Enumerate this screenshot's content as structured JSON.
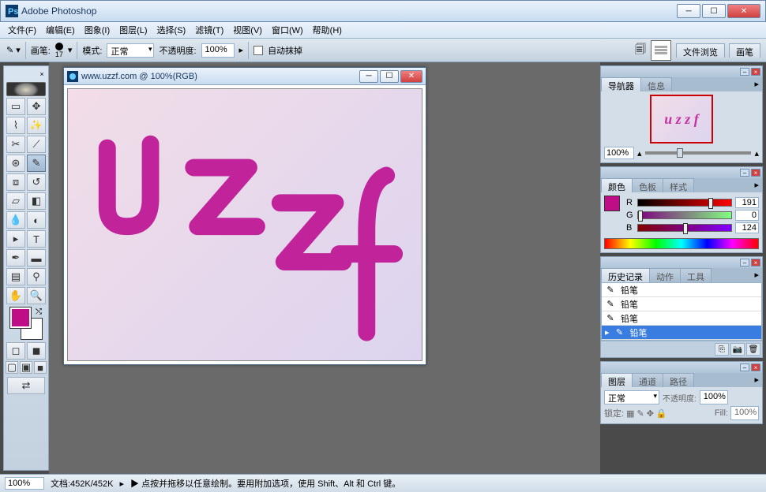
{
  "app": {
    "title": "Adobe Photoshop"
  },
  "menu": [
    "文件(F)",
    "编辑(E)",
    "图象(I)",
    "图层(L)",
    "选择(S)",
    "滤镜(T)",
    "视图(V)",
    "窗口(W)",
    "帮助(H)"
  ],
  "options": {
    "brush_label": "画笔:",
    "brush_size": "17",
    "mode_label": "模式:",
    "mode_value": "正常",
    "opacity_label": "不透明度:",
    "opacity_value": "100%",
    "auto_erase": "自动抹掉"
  },
  "palette_tabs": {
    "file_browse": "文件浏览",
    "brushes": "画笔"
  },
  "document": {
    "title": "www.uzzf.com @ 100%(RGB)"
  },
  "navigator": {
    "tab1": "导航器",
    "tab2": "信息",
    "zoom": "100%",
    "thumb_text": "u z z f"
  },
  "color": {
    "tab1": "颜色",
    "tab2": "色板",
    "tab3": "样式",
    "r_label": "R",
    "r_val": "191",
    "g_label": "G",
    "g_val": "0",
    "b_label": "B",
    "b_val": "124"
  },
  "history": {
    "tab1": "历史记录",
    "tab2": "动作",
    "tab3": "工具",
    "items": [
      "铅笔",
      "铅笔",
      "铅笔",
      "铅笔"
    ]
  },
  "layers": {
    "tab1": "图层",
    "tab2": "通道",
    "tab3": "路径",
    "mode": "正常",
    "opacity_label": "不透明度:",
    "opacity_val": "100%",
    "lock_label": "锁定:",
    "fill_label": "Fill:",
    "fill_val": "100%"
  },
  "status": {
    "zoom": "100%",
    "docinfo": "文档:452K/452K",
    "hint": "▶ 点按并拖移以任意绘制。要用附加选项，使用 Shift、Alt 和 Ctrl 键。"
  },
  "canvas_text": "u z z f"
}
